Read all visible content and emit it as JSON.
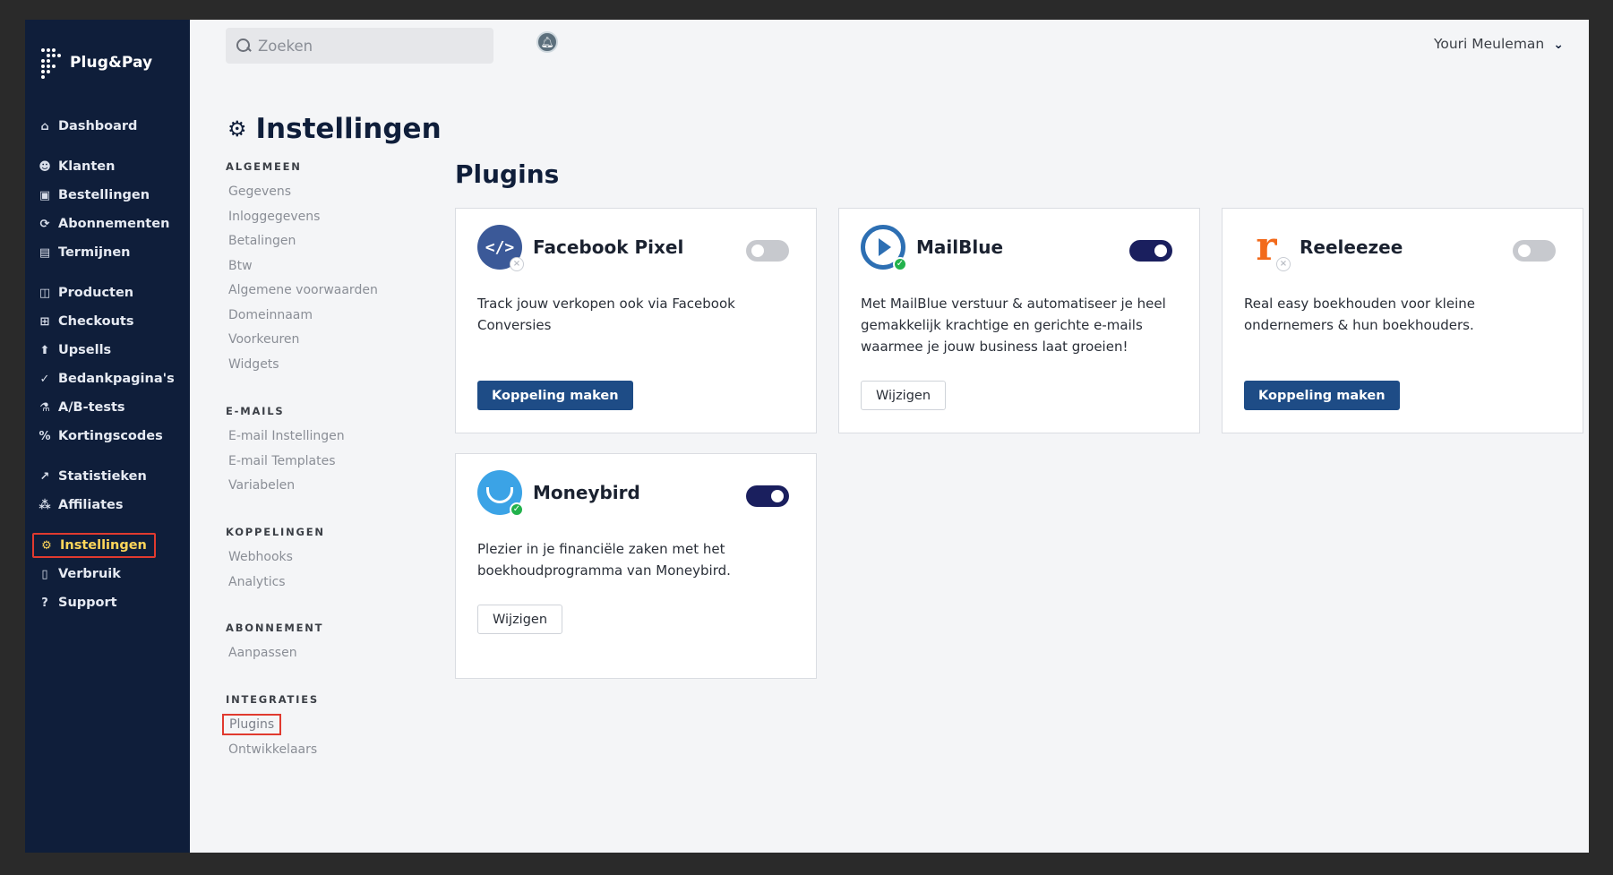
{
  "brand": {
    "name": "Plug&Pay"
  },
  "sidebar": {
    "items": [
      {
        "label": "Dashboard",
        "icon": "home-icon",
        "glyph": "⌂"
      },
      {
        "label": "Klanten",
        "icon": "users-icon",
        "glyph": "☻"
      },
      {
        "label": "Bestellingen",
        "icon": "cart-icon",
        "glyph": "▣"
      },
      {
        "label": "Abonnementen",
        "icon": "refresh-icon",
        "glyph": "⟳"
      },
      {
        "label": "Termijnen",
        "icon": "calendar-icon",
        "glyph": "▤"
      },
      {
        "label": "Producten",
        "icon": "box-icon",
        "glyph": "◫"
      },
      {
        "label": "Checkouts",
        "icon": "table-icon",
        "glyph": "⊞"
      },
      {
        "label": "Upsells",
        "icon": "arrow-up-circle-icon",
        "glyph": "⬆"
      },
      {
        "label": "Bedankpagina's",
        "icon": "check-icon",
        "glyph": "✓"
      },
      {
        "label": "A/B-tests",
        "icon": "flask-icon",
        "glyph": "⚗"
      },
      {
        "label": "Kortingscodes",
        "icon": "percent-icon",
        "glyph": "%"
      },
      {
        "label": "Statistieken",
        "icon": "chart-icon",
        "glyph": "↗"
      },
      {
        "label": "Affiliates",
        "icon": "network-icon",
        "glyph": "⁂"
      },
      {
        "label": "Instellingen",
        "icon": "gear-icon",
        "glyph": "⚙",
        "active": true
      },
      {
        "label": "Verbruik",
        "icon": "document-icon",
        "glyph": "▯"
      },
      {
        "label": "Support",
        "icon": "question-icon",
        "glyph": "?"
      }
    ]
  },
  "topbar": {
    "search_placeholder": "Zoeken",
    "user_name": "Youri Meuleman"
  },
  "settings": {
    "title": "Instellingen",
    "sections": [
      {
        "heading": "ALGEMEEN",
        "items": [
          "Gegevens",
          "Inloggegevens",
          "Betalingen",
          "Btw",
          "Algemene voorwaarden",
          "Domeinnaam",
          "Voorkeuren",
          "Widgets"
        ]
      },
      {
        "heading": "E-MAILS",
        "items": [
          "E-mail Instellingen",
          "E-mail Templates",
          "Variabelen"
        ]
      },
      {
        "heading": "KOPPELINGEN",
        "items": [
          "Webhooks",
          "Analytics"
        ]
      },
      {
        "heading": "ABONNEMENT",
        "items": [
          "Aanpassen"
        ]
      },
      {
        "heading": "INTEGRATIES",
        "items": [
          "Plugins",
          "Ontwikkelaars"
        ],
        "active_item": "Plugins"
      }
    ]
  },
  "plugins": {
    "title": "Plugins",
    "cards": [
      {
        "name": "Facebook Pixel",
        "description": "Track jouw verkopen ook via Facebook Conversies",
        "enabled": false,
        "button": "Koppeling maken",
        "button_style": "primary",
        "logo": "facebook-pixel-logo-icon",
        "color": "#3b5998"
      },
      {
        "name": "MailBlue",
        "description": "Met MailBlue verstuur & automatiseer je heel gemakkelijk krachtige en gerichte e-mails waarmee je jouw business laat groeien!",
        "enabled": true,
        "button": "Wijzigen",
        "button_style": "secondary",
        "logo": "mailblue-logo-icon",
        "color": "#2d6fb3"
      },
      {
        "name": "Reeleezee",
        "description": "Real easy boekhouden voor kleine ondernemers & hun boekhouders.",
        "enabled": false,
        "button": "Koppeling maken",
        "button_style": "primary",
        "logo": "reeleezee-logo-icon",
        "color": "#f26a1b"
      },
      {
        "name": "Moneybird",
        "description": "Plezier in je financiële zaken met het boekhoudprogramma van Moneybird.",
        "enabled": true,
        "button": "Wijzigen",
        "button_style": "secondary",
        "logo": "moneybird-logo-icon",
        "color": "#3ba3e6"
      }
    ]
  }
}
